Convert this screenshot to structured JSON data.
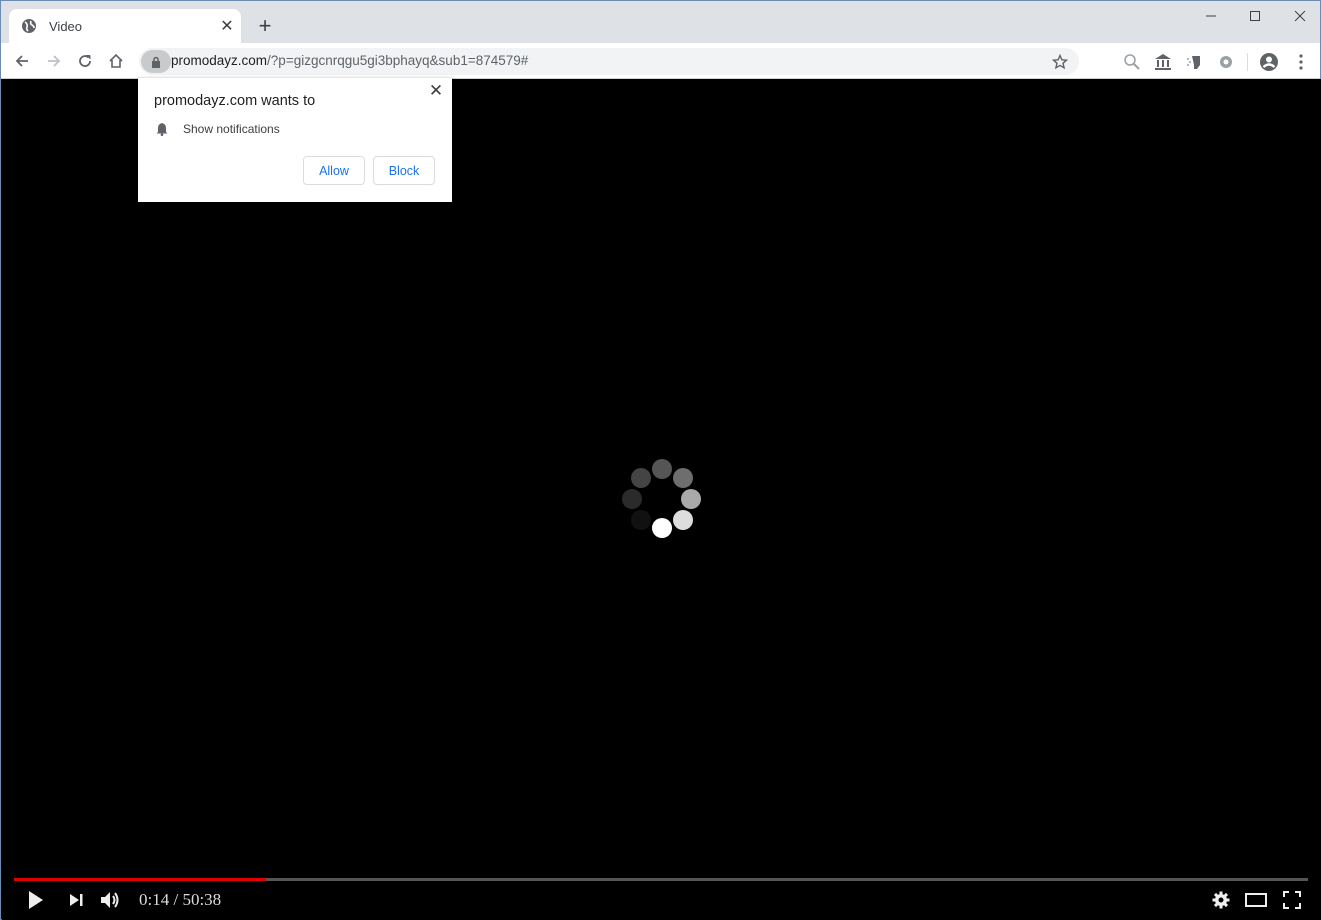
{
  "browser": {
    "tab": {
      "title": "Video",
      "icon": "globe-icon"
    },
    "new_tab_label": "+",
    "window_controls": [
      "minimize",
      "maximize",
      "close"
    ],
    "address_bar": {
      "domain": "promodayz.com",
      "path": "/?p=gizgcnrqgu5gi3bphayq&sub1=874579#",
      "security_icon": "lock-icon"
    },
    "extensions": [
      "search-extension-icon",
      "bank-extension-icon",
      "mask-extension-icon",
      "gear-extension-icon"
    ],
    "menu_icons": [
      "profile-icon",
      "kebab-menu-icon"
    ]
  },
  "permission_popup": {
    "heading": "promodayz.com wants to",
    "permission": "Show notifications",
    "permission_icon": "bell-icon",
    "allow_label": "Allow",
    "block_label": "Block",
    "close_label": "✕"
  },
  "video_player": {
    "state": "loading",
    "current_time": "0:14",
    "duration": "50:38",
    "time_display": "0:14 / 50:38",
    "progress_fraction": 0.195,
    "progress_color": "#e00000",
    "controls": [
      "play",
      "next",
      "volume",
      "settings",
      "theater",
      "fullscreen"
    ]
  }
}
